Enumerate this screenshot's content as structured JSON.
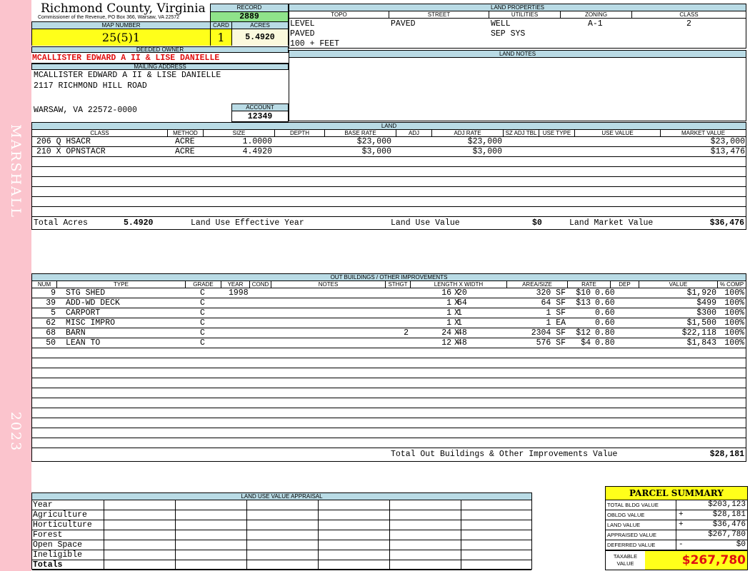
{
  "sidebar": {
    "district": "MARSHALL",
    "year": "2023"
  },
  "header": {
    "county": "Richmond County, Virginia",
    "commissioner": "Commissioner of the Revenue, PO Box 366, Warsaw, VA 22572"
  },
  "record": {
    "label": "RECORD",
    "value": "2889"
  },
  "map": {
    "map_label": "MAP NUMBER",
    "map_value": "25(5)1",
    "card_label": "CARD",
    "card_value": "1",
    "acres_label": "ACRES",
    "acres_value": "5.4920"
  },
  "owner": {
    "deeded_label": "DEEDED OWNER",
    "deeded_value": "MCALLISTER EDWARD A II & LISE DANIELLE",
    "mailing_label": "MAILING ADDRESS",
    "line1": "MCALLISTER EDWARD A II & LISE DANIELLE",
    "line2": "2117 RICHMOND HILL ROAD",
    "line3": "WARSAW, VA 22572-0000",
    "account_label": "ACCOUNT",
    "account_value": "12349"
  },
  "land_properties": {
    "title": "LAND PROPERTIES",
    "topo_label": "TOPO",
    "street_label": "STREET",
    "utilities_label": "UTILITIES",
    "zoning_label": "ZONING",
    "class_label": "CLASS",
    "topo": [
      "LEVEL",
      "PAVED",
      "100 + FEET"
    ],
    "street": "PAVED",
    "utilities": [
      "WELL",
      "SEP SYS"
    ],
    "zoning": "A-1",
    "class": "2"
  },
  "land_notes": {
    "title": "LAND NOTES"
  },
  "land": {
    "title": "LAND",
    "headers": [
      "CLASS",
      "METHOD",
      "SIZE",
      "DEPTH",
      "BASE RATE",
      "ADJ",
      "ADJ RATE",
      "SZ ADJ TBL",
      "USE TYPE",
      "USE VALUE",
      "MARKET VALUE"
    ],
    "rows": [
      {
        "cls": "206 Q HSACR",
        "method": "ACRE",
        "size": "1.0000",
        "base": "$23,000",
        "adj_rate": "$23,000",
        "market": "$23,000"
      },
      {
        "cls": "210 X OPNSTACR",
        "method": "ACRE",
        "size": "4.4920",
        "base": "$3,000",
        "adj_rate": "$3,000",
        "market": "$13,476"
      }
    ],
    "total_acres_label": "Total Acres",
    "total_acres": "5.4920",
    "effective_year_label": "Land Use Effective Year",
    "use_value_label": "Land Use Value",
    "use_value": "$0",
    "market_value_label": "Land Market Value",
    "market_value": "$36,476"
  },
  "outbuildings": {
    "title": "OUT BUILDINGS / OTHER IMPROVEMENTS",
    "headers": [
      "NUM",
      "TYPE",
      "GRADE",
      "YEAR",
      "COND",
      "NOTES",
      "STHGT",
      "LENGTH X WIDTH",
      "AREA/SIZE",
      "RATE",
      "DEP",
      "VALUE",
      "% COMP"
    ],
    "rows": [
      {
        "num": "9",
        "type": "STG SHED",
        "grade": "C",
        "year": "1998",
        "sthgt": "",
        "len": "16",
        "wid": "20",
        "area": "320 SF",
        "rate": "$10",
        "dep": "0.60",
        "value": "$1,920",
        "comp": "100%"
      },
      {
        "num": "39",
        "type": "ADD-WD DECK",
        "grade": "C",
        "year": "",
        "sthgt": "",
        "len": "1",
        "wid": "64",
        "area": "64 SF",
        "rate": "$13",
        "dep": "0.60",
        "value": "$499",
        "comp": "100%"
      },
      {
        "num": "5",
        "type": "CARPORT",
        "grade": "C",
        "year": "",
        "sthgt": "",
        "len": "1",
        "wid": "1",
        "area": "1 SF",
        "rate": "",
        "dep": "0.60",
        "value": "$300",
        "comp": "100%"
      },
      {
        "num": "62",
        "type": "MISC IMPRO",
        "grade": "C",
        "year": "",
        "sthgt": "",
        "len": "1",
        "wid": "1",
        "area": "1 EA",
        "rate": "",
        "dep": "0.60",
        "value": "$1,500",
        "comp": "100%"
      },
      {
        "num": "68",
        "type": "BARN",
        "grade": "C",
        "year": "",
        "sthgt": "2",
        "len": "24",
        "wid": "48",
        "area": "2304 SF",
        "rate": "$12",
        "dep": "0.80",
        "value": "$22,118",
        "comp": "100%"
      },
      {
        "num": "50",
        "type": "LEAN TO",
        "grade": "C",
        "year": "",
        "sthgt": "",
        "len": "12",
        "wid": "48",
        "area": "576 SF",
        "rate": "$4",
        "dep": "0.80",
        "value": "$1,843",
        "comp": "100%"
      }
    ],
    "total_label": "Total Out Buildings & Other Improvements Value",
    "total_value": "$28,181"
  },
  "land_use_appraisal": {
    "title": "LAND USE VALUE APPRAISAL",
    "rows": [
      "Year",
      "Agriculture",
      "Horticulture",
      "Forest",
      "Open Space",
      "Ineligible",
      "Totals"
    ]
  },
  "summary": {
    "title": "PARCEL SUMMARY",
    "rows": [
      {
        "label": "TOTAL BLDG VALUE",
        "op": "",
        "value": "$203,123"
      },
      {
        "label": "OBLDG VALUE",
        "op": "+",
        "value": "$28,181"
      },
      {
        "label": "LAND VALUE",
        "op": "+",
        "value": "$36,476"
      },
      {
        "label": "APPRAISED VALUE",
        "op": "",
        "value": "$267,780"
      },
      {
        "label": "DEFERRED VALUE",
        "op": "-",
        "value": "$0"
      }
    ],
    "taxable_label_1": "TAXABLE",
    "taxable_label_2": "VALUE",
    "taxable_value": "$267,780"
  }
}
